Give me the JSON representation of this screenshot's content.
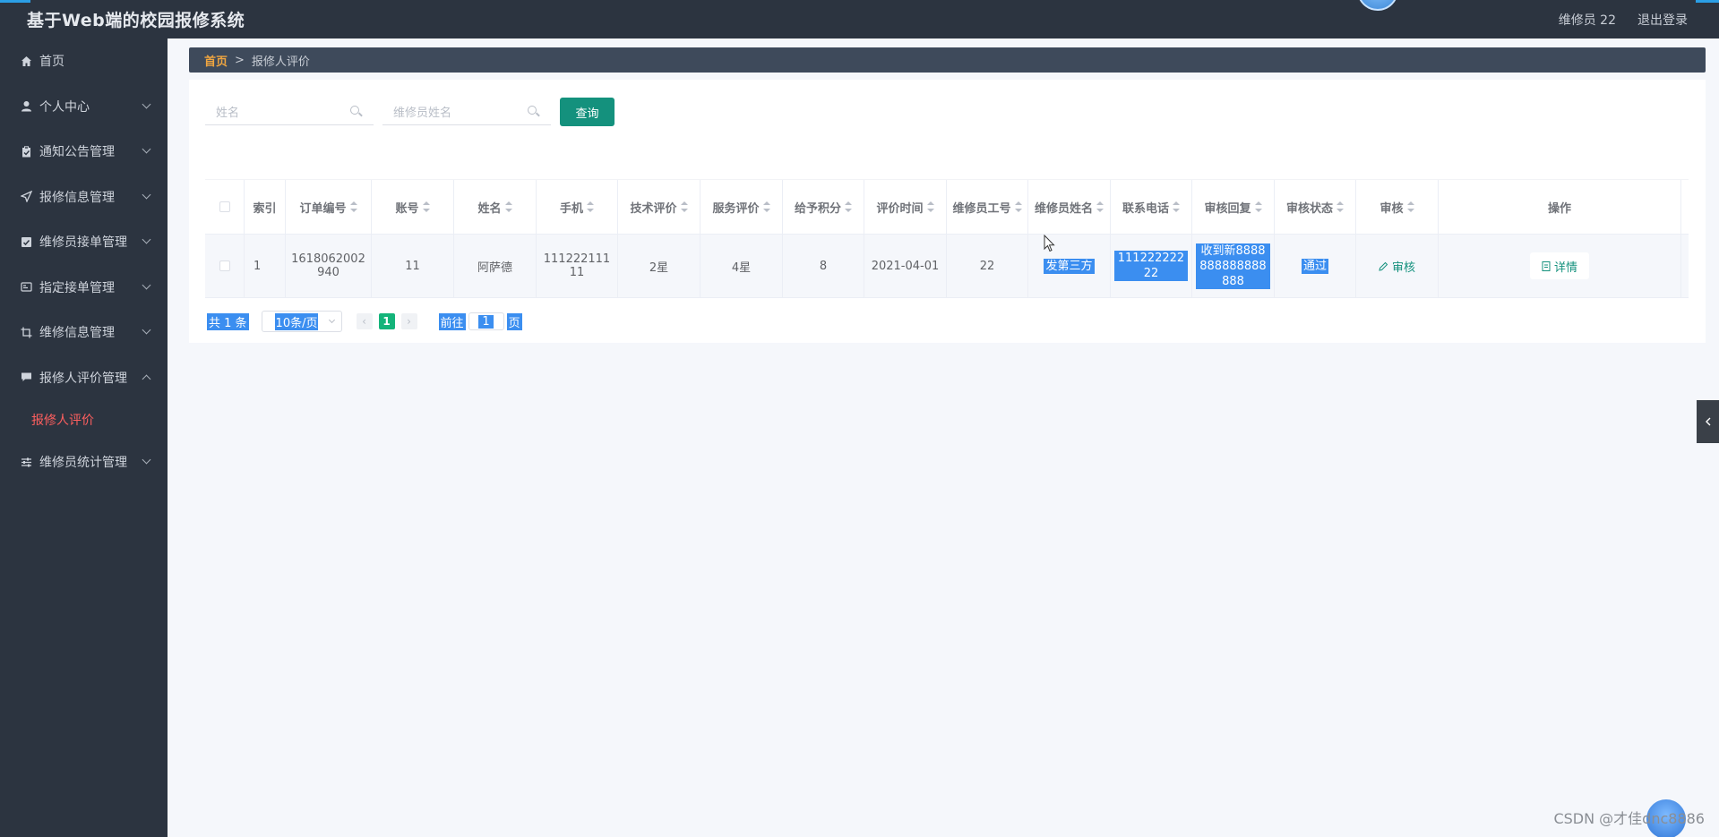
{
  "app": {
    "title": "基于Web端的校园报修系统",
    "user_label": "维修员 22",
    "logout_label": "退出登录",
    "colors": {
      "sidebar": "#2c3440",
      "accent": "#14917d",
      "active_sub": "#ff5f5f",
      "breadcrumb_home": "#f0a640",
      "selection": "#3b8ef0"
    }
  },
  "sidebar": {
    "items": [
      {
        "label": "首页",
        "icon": "home-icon"
      },
      {
        "label": "个人中心",
        "icon": "user-icon"
      },
      {
        "label": "通知公告管理",
        "icon": "clipboard-icon"
      },
      {
        "label": "报修信息管理",
        "icon": "send-icon"
      },
      {
        "label": "维修员接单管理",
        "icon": "checklist-icon"
      },
      {
        "label": "指定接单管理",
        "icon": "assign-icon"
      },
      {
        "label": "维修信息管理",
        "icon": "crop-icon"
      },
      {
        "label": "报修人评价管理",
        "icon": "comment-icon",
        "expanded": true
      },
      {
        "label": "维修员统计管理",
        "icon": "sliders-icon"
      }
    ],
    "active_sub": "报修人评价"
  },
  "breadcrumb": {
    "home": "首页",
    "separator": ">",
    "current": "报修人评价"
  },
  "search": {
    "name_placeholder": "姓名",
    "worker_name_placeholder": "维修员姓名",
    "query_label": "查询"
  },
  "table": {
    "headers": [
      "索引",
      "订单编号",
      "账号",
      "姓名",
      "手机",
      "技术评价",
      "服务评价",
      "给予积分",
      "评价时间",
      "维修员工号",
      "维修员姓名",
      "联系电话",
      "审核回复",
      "审核状态",
      "审核",
      "操作"
    ],
    "rows": [
      {
        "index": "1",
        "order_no": "1618062002940",
        "account": "11",
        "name": "阿萨德",
        "phone": "11122211111",
        "tech_rating": "2星",
        "service_rating": "4星",
        "points": "8",
        "review_time": "2021-04-01",
        "worker_id": "22",
        "worker_name": "发第三方",
        "contact_phone": "11122222222",
        "audit_reply": "收到新8888888888888888",
        "audit_status": "通过",
        "audit_action": "审核",
        "detail_action": "详情"
      }
    ]
  },
  "pagination": {
    "total": "共 1 条",
    "page_size": "10条/页",
    "current_page": "1",
    "goto_label": "前往",
    "goto_value": "1",
    "page_suffix": "页"
  },
  "watermark": "CSDN @才佳dnc8886"
}
